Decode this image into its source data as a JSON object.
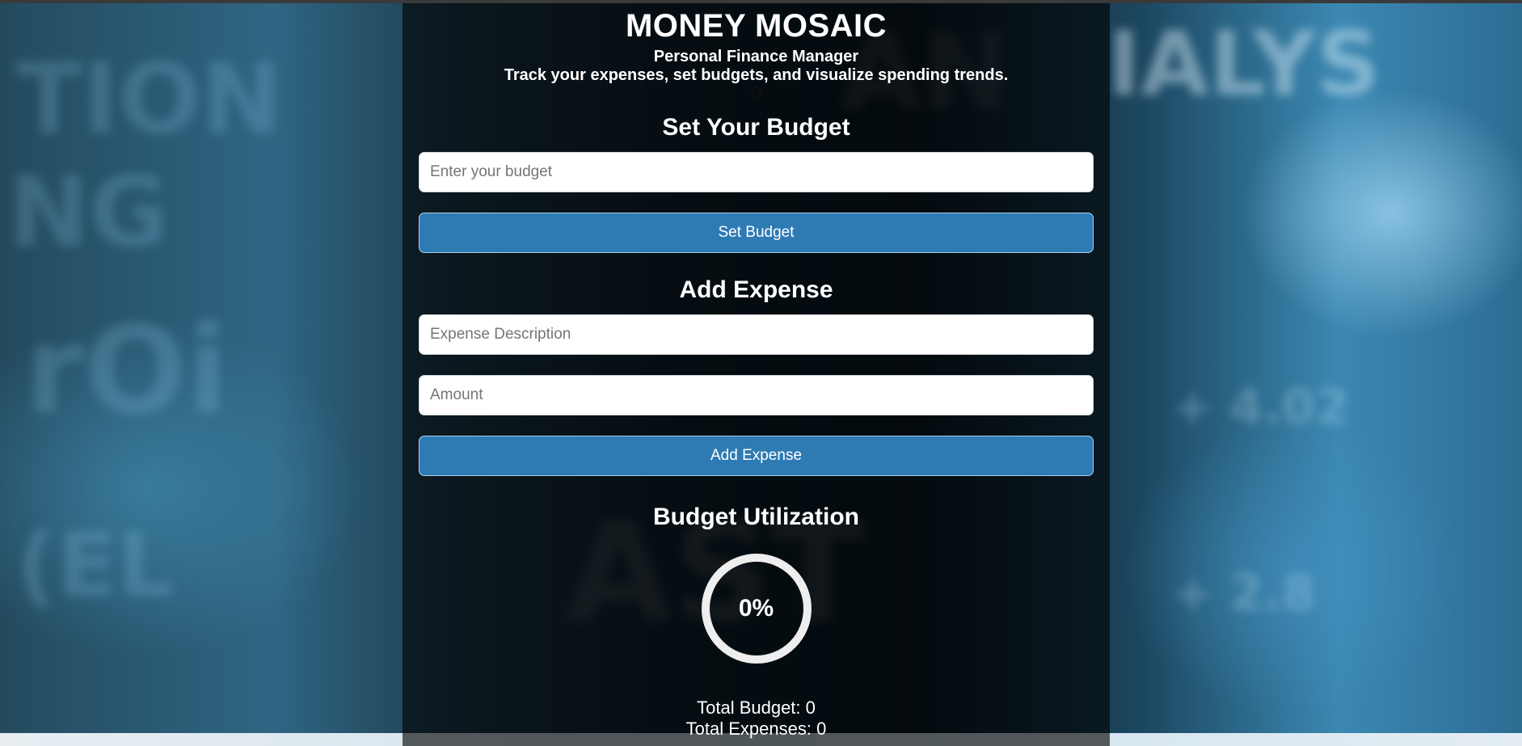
{
  "app": {
    "title": "MONEY MOSAIC",
    "subtitle": "Personal Finance Manager",
    "tagline": "Track your expenses, set budgets, and visualize spending trends.",
    "stray_glyph": "O"
  },
  "budget_section": {
    "heading": "Set Your Budget",
    "input_placeholder": "Enter your budget",
    "input_value": "",
    "button_label": "Set Budget"
  },
  "expense_section": {
    "heading": "Add Expense",
    "description_placeholder": "Expense Description",
    "description_value": "",
    "amount_placeholder": "Amount",
    "amount_value": "",
    "button_label": "Add Expense"
  },
  "utilization": {
    "heading": "Budget Utilization",
    "percent_label": "0%",
    "percent_value": 0,
    "ring_color": "#eeeeee",
    "fill_color": "#2e7bb4"
  },
  "totals": {
    "budget_line": "Total Budget: 0",
    "expenses_line": "Total Expenses: 0"
  },
  "colors": {
    "button": "#2e7bb4",
    "panel_overlay": "rgba(0,0,0,0.62)"
  }
}
